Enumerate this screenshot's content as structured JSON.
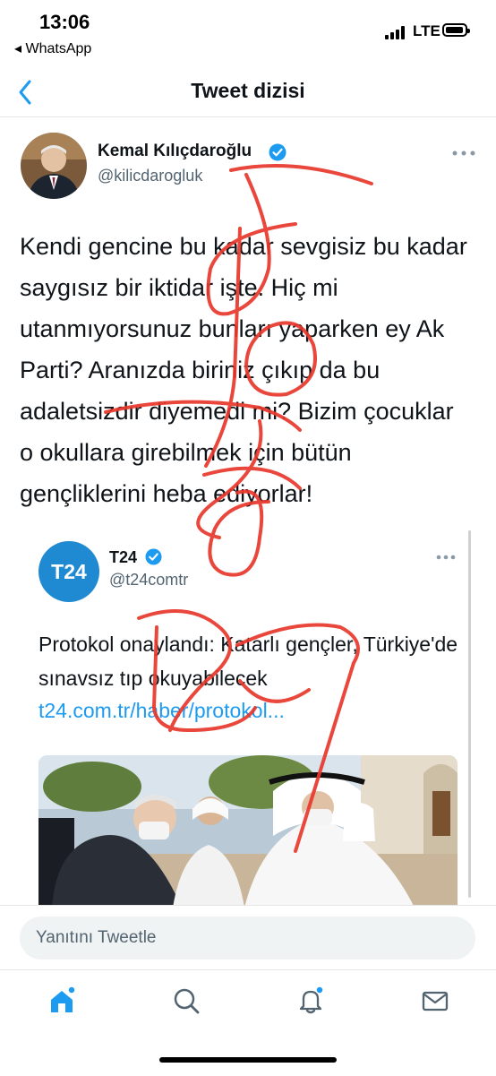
{
  "status_bar": {
    "time": "13:06",
    "back_app": "◂ WhatsApp",
    "network": "LTE"
  },
  "header": {
    "title": "Tweet dizisi"
  },
  "tweet": {
    "author_name": "Kemal Kılıçdaroğlu",
    "author_handle": "@kilicdarogluk",
    "text": "Kendi gencine bu kadar sevgisiz bu kadar saygısız bir iktidar işte. Hiç mi utanmıyorsunuz bunları yaparken ey Ak Parti? Aranızda biriniz çıkıp da bu adaletsizdir diyemedi mi? Bizim çocuklar o okullara girebilmek için bütün gençliklerini heba ediyorlar!"
  },
  "quoted_tweet": {
    "avatar_text": "T24",
    "author_name": "T24",
    "author_handle": "@t24comtr",
    "text": "Protokol onaylandı: Katarlı gençler, Türkiye'de sınavsız tıp okuyabilecek",
    "link": "t24.com.tr/haber/protokol..."
  },
  "reply": {
    "placeholder": "Yanıtını Tweetle"
  },
  "tabs": [
    {
      "name": "home-icon"
    },
    {
      "name": "search-icon"
    },
    {
      "name": "bell-icon"
    },
    {
      "name": "mail-icon"
    }
  ],
  "colors": {
    "accent": "#1d9bf0",
    "scribble": "#e8382c",
    "t24": "#1f8ad1"
  }
}
